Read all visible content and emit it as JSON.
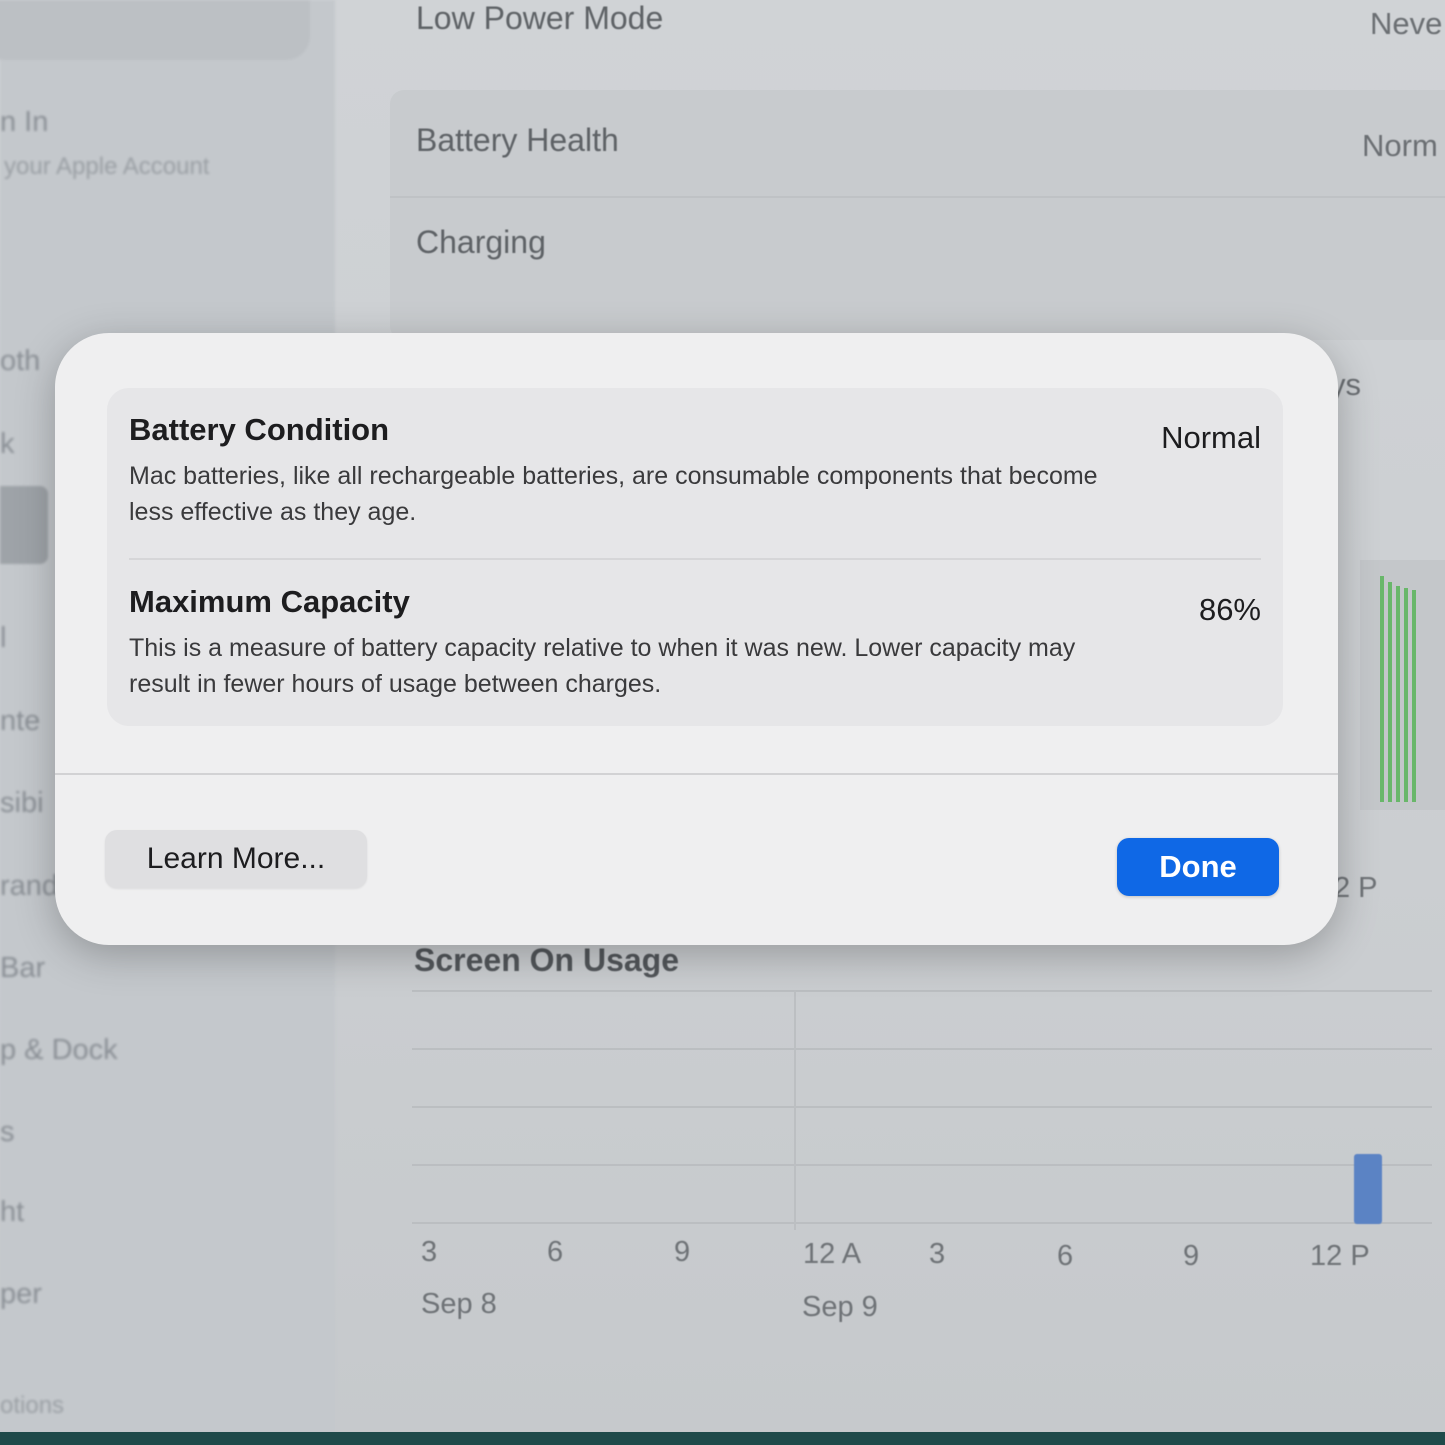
{
  "sidebar": {
    "sign_in": "n In",
    "sign_in_sub": "your Apple Account",
    "items": [
      "oth",
      "k",
      "l",
      "nte",
      "sibi",
      "rand",
      "Bar",
      "p & Dock",
      "s",
      "ht",
      "per",
      "otions"
    ]
  },
  "settings": {
    "low_power_mode": {
      "label": "Low Power Mode",
      "value": "Neve"
    },
    "battery_health": {
      "label": "Battery Health",
      "value": "Norm"
    },
    "charging": {
      "label": "Charging"
    },
    "days_fragment": "ys",
    "tick_fragment": "2 P"
  },
  "screen_on_usage": {
    "title": "Screen On Usage",
    "x_ticks": [
      "3",
      "6",
      "9",
      "12 A",
      "3",
      "6",
      "9",
      "12 P"
    ],
    "dates": [
      "Sep 8",
      "Sep 9"
    ]
  },
  "dialog": {
    "battery_condition": {
      "title": "Battery Condition",
      "description": "Mac batteries, like all rechargeable batteries, are consumable components that become less effective as they age.",
      "value": "Normal"
    },
    "maximum_capacity": {
      "title": "Maximum Capacity",
      "description": "This is a measure of battery capacity relative to when it was new. Lower capacity may result in fewer hours of usage between charges.",
      "value": "86%"
    },
    "learn_more_label": "Learn More...",
    "done_label": "Done"
  },
  "colors": {
    "accent": "#0f68e6",
    "usage_bar": "#5b83c4",
    "battery_level": "#5fb55f"
  }
}
